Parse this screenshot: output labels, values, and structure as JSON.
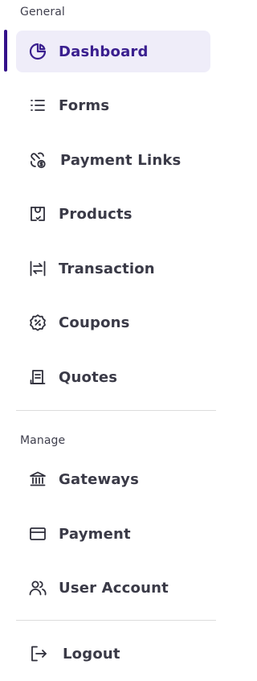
{
  "sections": {
    "general_label": "General",
    "manage_label": "Manage"
  },
  "nav": {
    "dashboard": {
      "label": "Dashboard",
      "icon": "pie-chart-icon"
    },
    "forms": {
      "label": "Forms",
      "icon": "list-icon"
    },
    "payment_links": {
      "label": "Payment Links",
      "icon": "payment-link-icon"
    },
    "products": {
      "label": "Products",
      "icon": "product-bag-icon"
    },
    "transaction": {
      "label": "Transaction",
      "icon": "transfer-arrows-icon"
    },
    "coupons": {
      "label": "Coupons",
      "icon": "discount-badge-icon"
    },
    "quotes": {
      "label": "Quotes",
      "icon": "receipt-icon"
    },
    "gateways": {
      "label": "Gateways",
      "icon": "bank-icon"
    },
    "payment": {
      "label": "Payment",
      "icon": "credit-card-icon"
    },
    "user_account": {
      "label": "User Account",
      "icon": "users-icon"
    },
    "logout": {
      "label": "Logout",
      "icon": "logout-icon"
    }
  },
  "colors": {
    "accent": "#3a1f8f",
    "active_background": "#efedf9",
    "text": "#3a3a47",
    "divider": "#dcdcdc"
  }
}
